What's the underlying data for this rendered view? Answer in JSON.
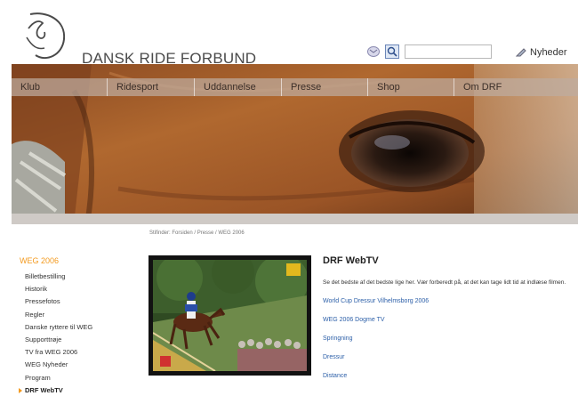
{
  "header": {
    "brand": "DANSK RIDE FORBUND",
    "news_label": "Nyheder",
    "search_placeholder": ""
  },
  "nav": {
    "items": [
      "Klub",
      "Ridesport",
      "Uddannelse",
      "Presse",
      "Shop",
      "Om DRF"
    ]
  },
  "breadcrumb": "Stifinder: Forsiden / Presse / WEG 2006",
  "sidebar": {
    "section": "WEG 2006",
    "items": [
      "Billetbestilling",
      "Historik",
      "Pressefotos",
      "Regler",
      "Danske ryttere til WEG",
      "Supporttrøje",
      "TV fra WEG 2006",
      "WEG Nyheder",
      "Program",
      "DRF WebTV"
    ],
    "active_index": 9
  },
  "main": {
    "title": "DRF WebTV",
    "intro": "Se det bedste af det bedste lige her. Vær forberedt på, at det kan tage lidt tid at indlæse filmen.",
    "links": [
      "World Cup Dressur Vilhelmsborg 2006",
      "WEG 2006 Dogme TV",
      "Springning",
      "Dressur",
      "Distance"
    ]
  },
  "colors": {
    "accent": "#f39a1f",
    "link": "#2c5fa8",
    "nav_bar": "#bfae9f"
  },
  "icons": {
    "logo": "horse-head-logo",
    "mail": "mail-icon",
    "search": "search-icon",
    "news": "pencil-icon"
  }
}
